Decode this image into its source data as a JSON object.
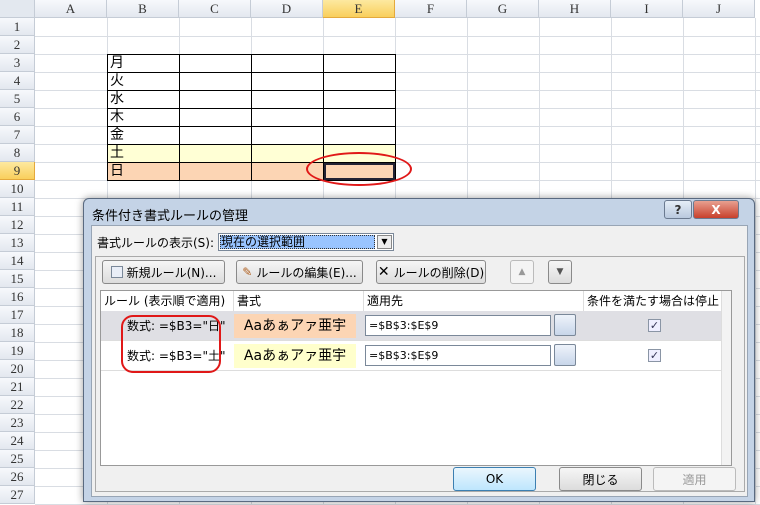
{
  "sheet": {
    "columns": [
      "A",
      "B",
      "C",
      "D",
      "E",
      "F",
      "G",
      "H",
      "I",
      "J"
    ],
    "selected_column": "E",
    "rows": [
      "1",
      "2",
      "3",
      "4",
      "5",
      "6",
      "7",
      "8",
      "9",
      "10",
      "11",
      "12",
      "13",
      "14",
      "15",
      "16",
      "17",
      "18",
      "19",
      "20",
      "21",
      "22",
      "23",
      "24",
      "25",
      "26",
      "27"
    ],
    "selected_row": "9",
    "table_days": [
      "月",
      "火",
      "水",
      "木",
      "金",
      "土",
      "日"
    ],
    "colors": {
      "saturday_fill": "#ffffd5",
      "sunday_fill": "#fcd5b4",
      "highlight_ring": "#e01818"
    }
  },
  "dialog": {
    "title": "条件付き書式ルールの管理",
    "help_button": "?",
    "close_button": "X",
    "show_rules_label": "書式ルールの表示(S):",
    "show_rules_value": "現在の選択範囲",
    "new_rule": "新規ルール(N)...",
    "edit_rule": "ルールの編集(E)...",
    "delete_rule": "ルールの削除(D)",
    "headers": {
      "rule": "ルール (表示順で適用)",
      "format": "書式",
      "applies_to": "適用先",
      "stop_if_true": "条件を満たす場合は停止"
    },
    "rules": [
      {
        "rule": "数式: =$B3=\"日\"",
        "preview": "Aaあぁアァ亜宇",
        "preview_color": "#fcd5b4",
        "applies_to": "=$B$3:$E$9",
        "stop_if_true": true,
        "selected": true
      },
      {
        "rule": "数式: =$B3=\"土\"",
        "preview": "Aaあぁアァ亜宇",
        "preview_color": "#ffffcc",
        "applies_to": "=$B$3:$E$9",
        "stop_if_true": true,
        "selected": false
      }
    ],
    "ok": "OK",
    "close": "閉じる",
    "apply": "適用"
  }
}
